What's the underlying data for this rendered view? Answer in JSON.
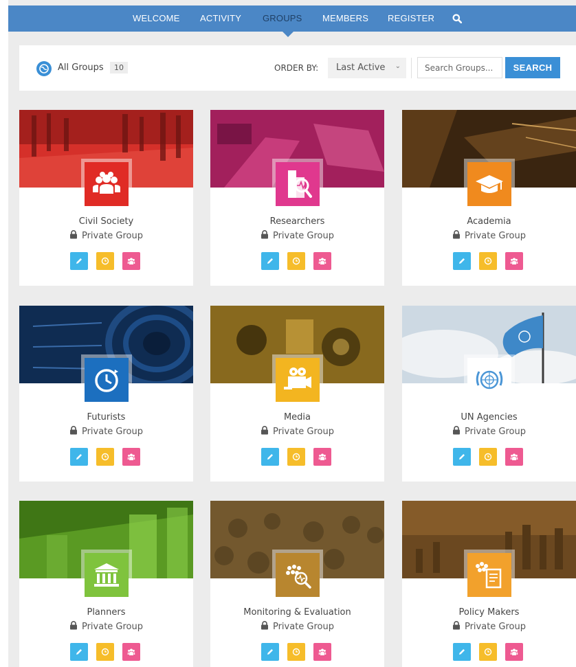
{
  "nav": {
    "items": [
      {
        "label": "WELCOME",
        "active": false
      },
      {
        "label": "ACTIVITY",
        "active": false
      },
      {
        "label": "GROUPS",
        "active": true
      },
      {
        "label": "MEMBERS",
        "active": false
      },
      {
        "label": "REGISTER",
        "active": false
      }
    ],
    "search_icon": "search-icon"
  },
  "filter": {
    "all_groups_label": "All Groups",
    "all_groups_count": "10",
    "order_by_label": "ORDER BY:",
    "order_value": "Last Active",
    "search_placeholder": "Search Groups...",
    "search_button": "SEARCH"
  },
  "groups": [
    {
      "name": "Civil Society",
      "privacy": "Private Group",
      "icon": "people-group-icon",
      "color": "#e02b25"
    },
    {
      "name": "Researchers",
      "privacy": "Private Group",
      "icon": "research-document-icon",
      "color": "#e0388e"
    },
    {
      "name": "Academia",
      "privacy": "Private Group",
      "icon": "graduation-cap-icon",
      "color": "#f08a1e"
    },
    {
      "name": "Futurists",
      "privacy": "Private Group",
      "icon": "clock-icon",
      "color": "#1c6fbf"
    },
    {
      "name": "Media",
      "privacy": "Private Group",
      "icon": "video-camera-icon",
      "color": "#f3b520"
    },
    {
      "name": "UN Agencies",
      "privacy": "Private Group",
      "icon": "un-emblem-icon",
      "color": "#6aa9dc"
    },
    {
      "name": "Planners",
      "privacy": "Private Group",
      "icon": "institution-icon",
      "color": "#7fc33d"
    },
    {
      "name": "Monitoring & Evaluation",
      "privacy": "Private Group",
      "icon": "people-magnifier-icon",
      "color": "#b8862f"
    },
    {
      "name": "Policy Makers",
      "privacy": "Private Group",
      "icon": "policy-document-icon",
      "color": "#f2a12c"
    }
  ],
  "action_buttons": {
    "edit": {
      "icon": "pencil-icon",
      "color": "#3fb6ea"
    },
    "activity": {
      "icon": "clock-icon",
      "color": "#f6bd2a"
    },
    "members": {
      "icon": "members-icon",
      "color": "#ee5a91"
    }
  }
}
